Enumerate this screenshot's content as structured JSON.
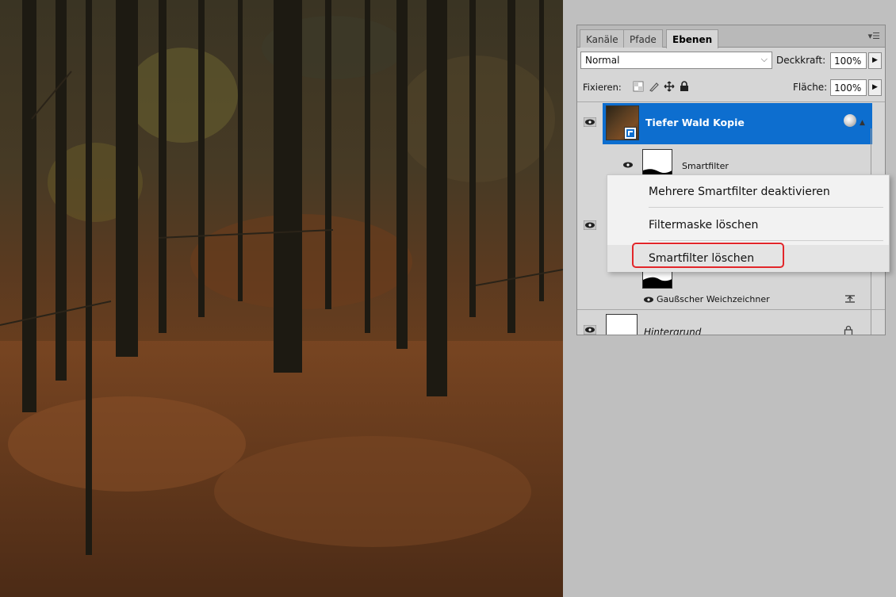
{
  "tabs": [
    {
      "label": "Kanäle",
      "active": false
    },
    {
      "label": "Pfade",
      "active": false
    },
    {
      "label": "Ebenen",
      "active": true
    }
  ],
  "panel_menu_icon": "panel-menu-icon",
  "blend_mode": "Normal",
  "opacity_label": "Deckkraft:",
  "opacity_value": "100%",
  "lock_label": "Fixieren:",
  "fill_label": "Fläche:",
  "fill_value": "100%",
  "layers": {
    "layer1_name": "Tiefer Wald Kopie",
    "smartfilter_label": "Smartfilter",
    "filter_name": "Gaußscher Weichzeichner",
    "background_name": "Hintergrund"
  },
  "context_menu": {
    "items": [
      "Mehrere Smartfilter deaktivieren",
      "Filtermaske löschen",
      "Smartfilter löschen"
    ],
    "highlighted_index": 2,
    "highlight_color": "#e2262a"
  },
  "colors": {
    "selection": "#0d6ecf",
    "panel_bg": "#d6d6d6",
    "workspace_bg": "#bfbfbf"
  },
  "icons": [
    "eye-icon",
    "chevron-down-icon",
    "triangle-right-icon",
    "lock-transparent-icon",
    "brush-icon",
    "move-icon",
    "lock-icon",
    "smart-object-icon",
    "fx-options-icon",
    "filter-options-icon"
  ]
}
